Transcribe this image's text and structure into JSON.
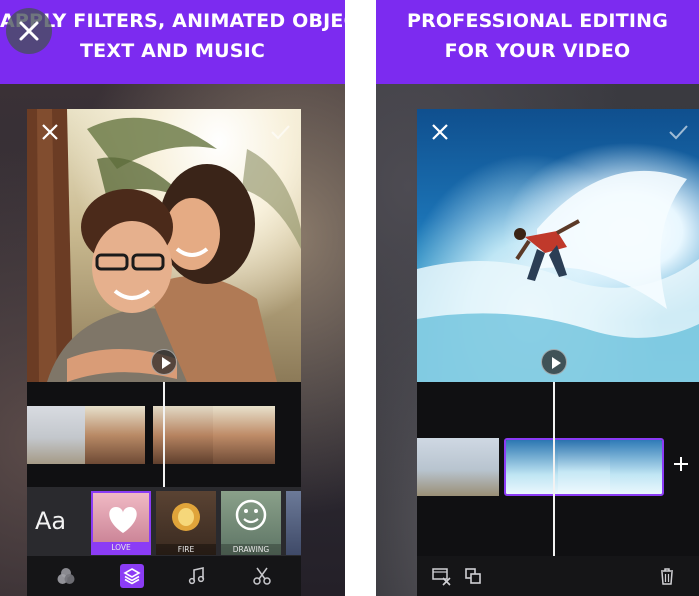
{
  "left_panel": {
    "caption_line1": "APPLY FILTERS, ANIMATED OBJECTS,",
    "caption_line2": "TEXT AND MUSIC",
    "text_tool_label": "Aa",
    "effects": [
      {
        "label": "LOVE",
        "selected": true
      },
      {
        "label": "FIRE",
        "selected": false
      },
      {
        "label": "DRAWING",
        "selected": false
      }
    ],
    "toolbar_icons": [
      "filters-icon",
      "layers-icon",
      "music-icon",
      "scissors-icon"
    ]
  },
  "right_panel": {
    "caption_line1": "PROFESSIONAL EDITING",
    "caption_line2": "FOR YOUR VIDEO",
    "toolbar_icons": [
      "transition-icon",
      "duplicate-icon",
      "trash-icon"
    ]
  },
  "colors": {
    "brand_purple": "#7c2bf0",
    "selection_purple": "#8b3cf5",
    "dark_ui": "#1b1b1e"
  }
}
